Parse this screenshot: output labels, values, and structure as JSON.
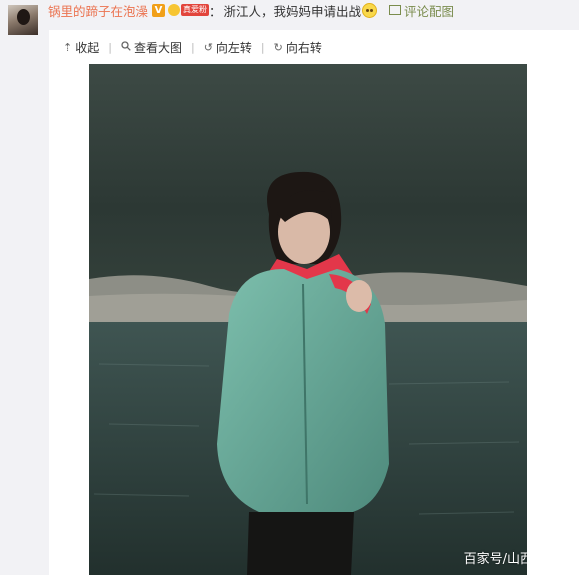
{
  "post": {
    "username": "锅里的蹄子在泡澡",
    "verified_badge": "V",
    "fan_badge": "真爱粉",
    "colon": "：",
    "comment": "浙江人，我妈妈申请出战",
    "emoji_icon": "shy-face-emoji",
    "pic_comment_label": "评论配图"
  },
  "toolbar": {
    "collapse_label": "收起",
    "view_large_label": "查看大图",
    "rotate_left_label": "向左转",
    "rotate_right_label": "向右转"
  },
  "photo": {
    "watermark": "百家号/山西"
  },
  "colors": {
    "username": "#eb7350",
    "pic_comment": "#7a8c4d",
    "background": "#f2f2f5",
    "card": "#ffffff"
  }
}
